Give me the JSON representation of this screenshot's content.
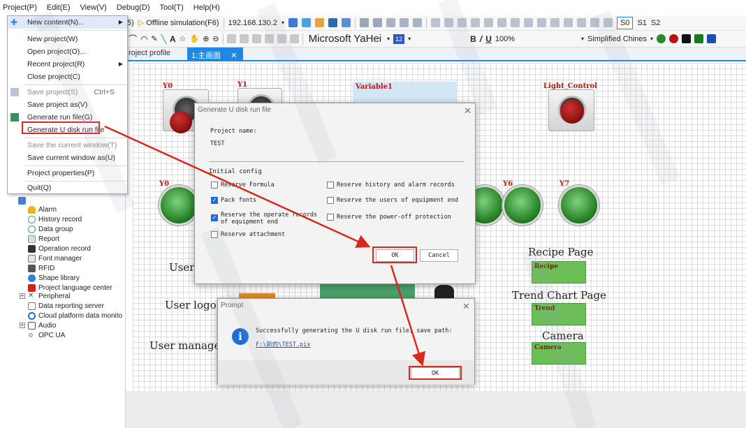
{
  "menubar": {
    "items": [
      "Project(P)",
      "Edit(E)",
      "View(V)",
      "Debug(D)",
      "Tool(T)",
      "Help(H)"
    ]
  },
  "toolbar": {
    "partial_left": "5)",
    "offline_sim": "Offline simulation(F6)",
    "ip": "192.168.130.2",
    "font_name": "Microsoft YaHei",
    "font_size": "12",
    "zoom": "100%",
    "language": "Simplified Chines",
    "screen_labels": [
      "S0",
      "S1",
      "S2"
    ]
  },
  "tabs": {
    "profile": "roject profile",
    "main": "1:主画面"
  },
  "project_menu": {
    "items": [
      {
        "label": "New content(N)...",
        "submenu": true,
        "disabled": false
      },
      {
        "label": "New project(W)",
        "disabled": false
      },
      {
        "label": "Open project(O)...",
        "disabled": false
      },
      {
        "label": "Recent project(R)",
        "submenu": true,
        "disabled": false
      },
      {
        "label": "Close project(C)",
        "disabled": false
      },
      {
        "label": "Save project(S)",
        "shortcut": "Ctrl+S",
        "disabled": true
      },
      {
        "label": "Save project as(V)",
        "disabled": false
      },
      {
        "label": "Generate run file(G)",
        "disabled": false
      },
      {
        "label": "Generate U disk run file",
        "disabled": false
      },
      {
        "label": "Save the current window(T)",
        "disabled": true
      },
      {
        "label": "Save current window as(U)",
        "disabled": false
      },
      {
        "label": "Project properties(P)",
        "disabled": false
      },
      {
        "label": "Quit(Q)",
        "disabled": false
      }
    ]
  },
  "tree": {
    "items": [
      "Alarm",
      "History record",
      "Data group",
      "Report",
      "Operation record",
      "Font manager",
      "RFID",
      "Shape library",
      "Project language center",
      "Peripheral",
      "Data reporting server",
      "Cloud platform data monito",
      "Audio",
      "OPC UA"
    ]
  },
  "canvas": {
    "switch_labels": [
      "Y0",
      "Y1"
    ],
    "variable_label": "Variable1",
    "light_control_label": "Light_Control",
    "lamp_labels": [
      "Y0",
      "Y6",
      "Y7"
    ],
    "user_text": "User",
    "user_logo_text": "User logo",
    "user_manager_text": "User manager",
    "recipe_page_text": "Recipe Page",
    "recipe_box": "Recipe",
    "trend_page_text": "Trend Chart Page",
    "trend_box": "Trend",
    "camera_text": "Camera",
    "camera_box": "Camera"
  },
  "generate_dialog": {
    "title": "Generate U disk run file",
    "project_name_label": "Project name:",
    "project_name_value": "TEST",
    "initial_config_label": "Initial config",
    "options": [
      {
        "label": "Reserve Formula",
        "checked": false
      },
      {
        "label": "Reserve history and alarm records",
        "checked": false
      },
      {
        "label": "Pack fonts",
        "checked": true
      },
      {
        "label": "Reserve the users of equipment end",
        "checked": false
      },
      {
        "label": "Reserve the operate records of equipment end",
        "checked": true
      },
      {
        "label": "Reserve the power-off protection",
        "checked": false
      },
      {
        "label": "Reserve attachment",
        "checked": false
      }
    ],
    "ok_label": "OK",
    "cancel_label": "Cancel"
  },
  "prompt_dialog": {
    "title": "Prompt",
    "message": "Successfully generating the U disk run file, save path:",
    "path": "F:\\新的\\TEST.pix",
    "ok_label": "OK"
  },
  "colors": {
    "accent": "#1e88e5",
    "annotation_red": "#d9281e",
    "lamp_green": "#2f9a2f",
    "box_green": "#6cbe57"
  }
}
